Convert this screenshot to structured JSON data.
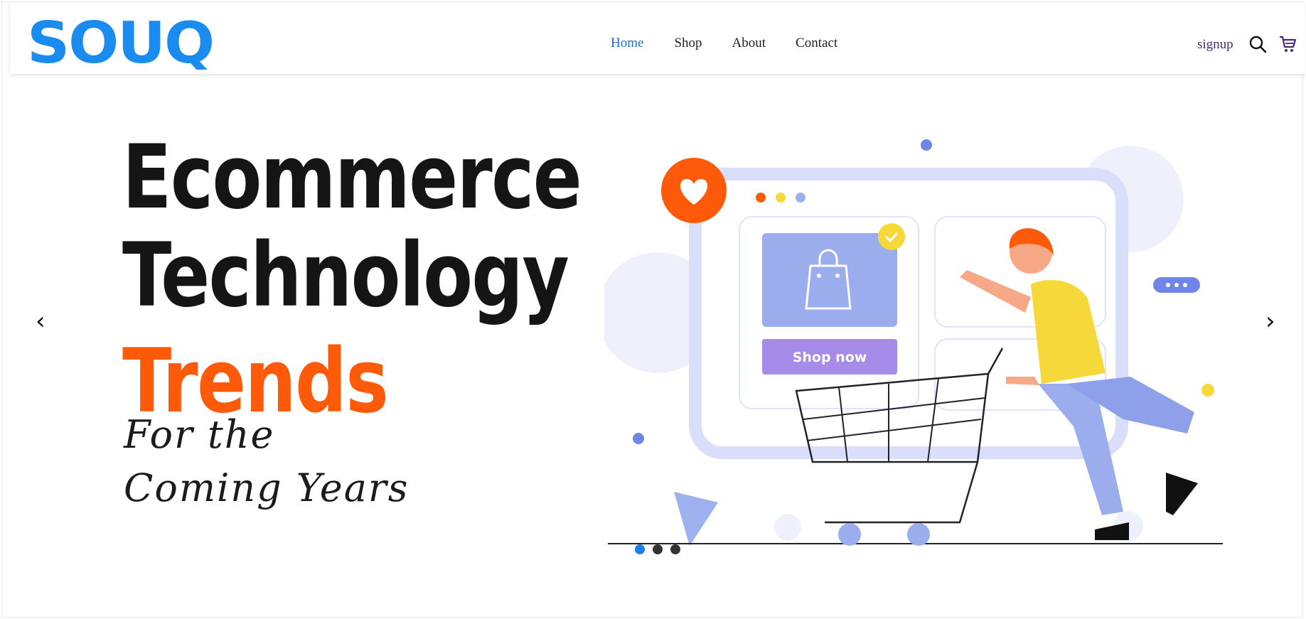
{
  "header": {
    "logo_text": "SOUQ",
    "nav": [
      {
        "label": "Home",
        "active": true
      },
      {
        "label": "Shop",
        "active": false
      },
      {
        "label": "About",
        "active": false
      },
      {
        "label": "Contact",
        "active": false
      }
    ],
    "signup_label": "signup",
    "icons": [
      "search-icon",
      "cart-icon"
    ]
  },
  "hero": {
    "prev_arrow": "‹",
    "next_arrow": "›",
    "line1": "Ecommerce",
    "line2": "Technology",
    "line3": "Trends",
    "sub1": "For the",
    "sub2": "Coming Years",
    "illustration_button": "Shop now",
    "slides": 3,
    "active_slide": 1
  },
  "colors": {
    "brand_blue": "#1a8cf0",
    "active_link": "#1a73c9",
    "accent_orange": "#ff5a0a",
    "dot_active": "#1a7ff0"
  }
}
